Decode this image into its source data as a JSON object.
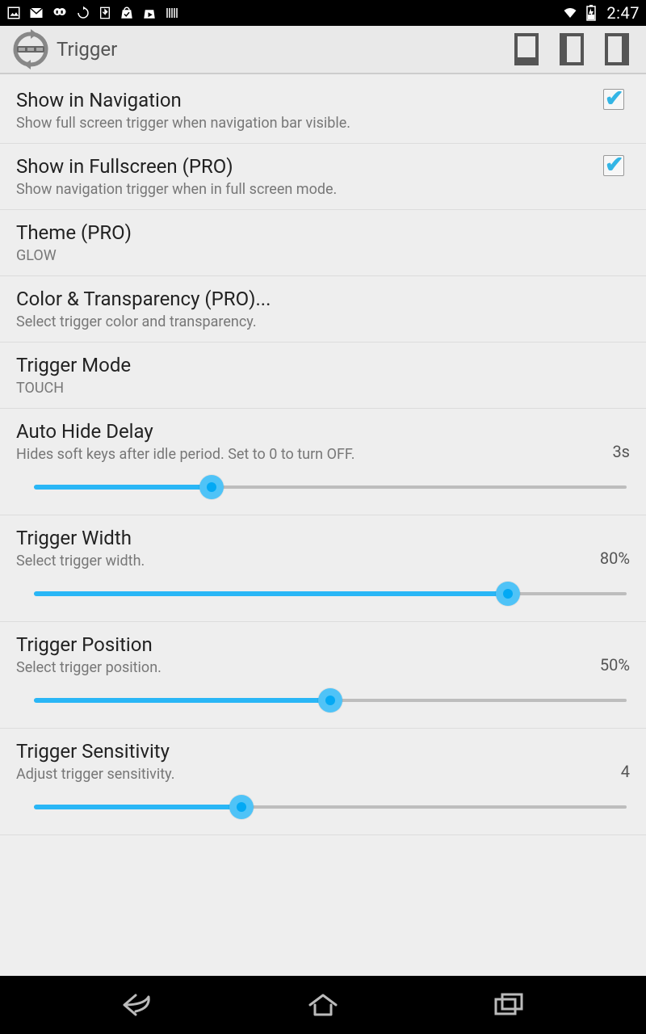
{
  "status": {
    "time": "2:47"
  },
  "actionBar": {
    "title": "Trigger"
  },
  "settings": {
    "showInNav": {
      "title": "Show in Navigation",
      "sub": "Show full screen trigger when navigation bar visible.",
      "checked": true
    },
    "showInFullscreen": {
      "title": "Show in Fullscreen (PRO)",
      "sub": "Show navigation trigger when in full screen mode.",
      "checked": true
    },
    "theme": {
      "title": "Theme (PRO)",
      "sub": "GLOW"
    },
    "colorTrans": {
      "title": "Color & Transparency (PRO)...",
      "sub": "Select trigger color and transparency."
    },
    "triggerMode": {
      "title": "Trigger Mode",
      "sub": "TOUCH"
    },
    "autoHide": {
      "title": "Auto Hide Delay",
      "sub": "Hides soft keys after idle period. Set to 0 to turn OFF.",
      "value": "3s",
      "sliderPct": 30
    },
    "triggerWidth": {
      "title": "Trigger Width",
      "sub": "Select trigger width.",
      "value": "80%",
      "sliderPct": 80
    },
    "triggerPos": {
      "title": "Trigger Position",
      "sub": "Select trigger position.",
      "value": "50%",
      "sliderPct": 50
    },
    "triggerSens": {
      "title": "Trigger Sensitivity",
      "sub": "Adjust trigger sensitivity.",
      "value": "4",
      "sliderPct": 35
    }
  }
}
